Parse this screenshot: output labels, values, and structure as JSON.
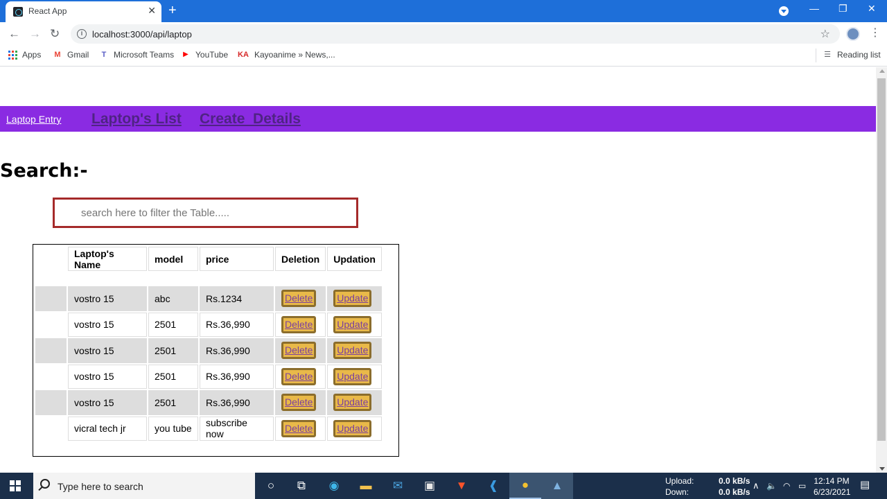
{
  "browser": {
    "tab_title": "React App",
    "tab_close": "✕",
    "new_tab": "+",
    "url": "localhost:3000/api/laptop",
    "bookmarks": [
      {
        "label": "Apps",
        "icon": "apps-grid-icon"
      },
      {
        "label": "Gmail",
        "icon": "gmail-icon",
        "glyph": "M",
        "color": "#ea4335"
      },
      {
        "label": "Microsoft Teams",
        "icon": "teams-icon",
        "glyph": "T",
        "color": "#5b5fc7"
      },
      {
        "label": "YouTube",
        "icon": "youtube-icon",
        "glyph": "▶",
        "color": "#ff0000"
      },
      {
        "label": "Kayoanime » News,...",
        "icon": "kayoanime-icon",
        "glyph": "KA",
        "color": "#d62828"
      }
    ],
    "reading_list": "Reading list"
  },
  "navbar": {
    "brand": "Laptop Entry",
    "links": [
      "Laptop's List",
      "Create  Details"
    ],
    "bg_color": "#8a2be2"
  },
  "search": {
    "heading": "Search:-",
    "placeholder": "search here to filter the Table....."
  },
  "table": {
    "headers": [
      "Laptop's Name",
      "model",
      "price",
      "Deletion",
      "Updation"
    ],
    "rows": [
      {
        "name": "vostro 15",
        "model": "abc",
        "price": "Rs.1234"
      },
      {
        "name": "vostro 15",
        "model": "2501",
        "price": "Rs.36,990"
      },
      {
        "name": "vostro 15",
        "model": "2501",
        "price": "Rs.36,990"
      },
      {
        "name": "vostro 15",
        "model": "2501",
        "price": "Rs.36,990"
      },
      {
        "name": "vostro 15",
        "model": "2501",
        "price": "Rs.36,990"
      },
      {
        "name": "vicral tech jr",
        "model": "you tube",
        "price": "subscribe now"
      }
    ],
    "delete_label": "Delete",
    "update_label": "Update",
    "button_color": "#e9b949"
  },
  "taskbar": {
    "search_placeholder": "Type here to search",
    "upload_label": "Upload:",
    "download_label": "Down:",
    "upload_value": "0.0 kB/s",
    "download_value": "0.0 kB/s",
    "time": "12:14 PM",
    "date": "6/23/2021"
  }
}
